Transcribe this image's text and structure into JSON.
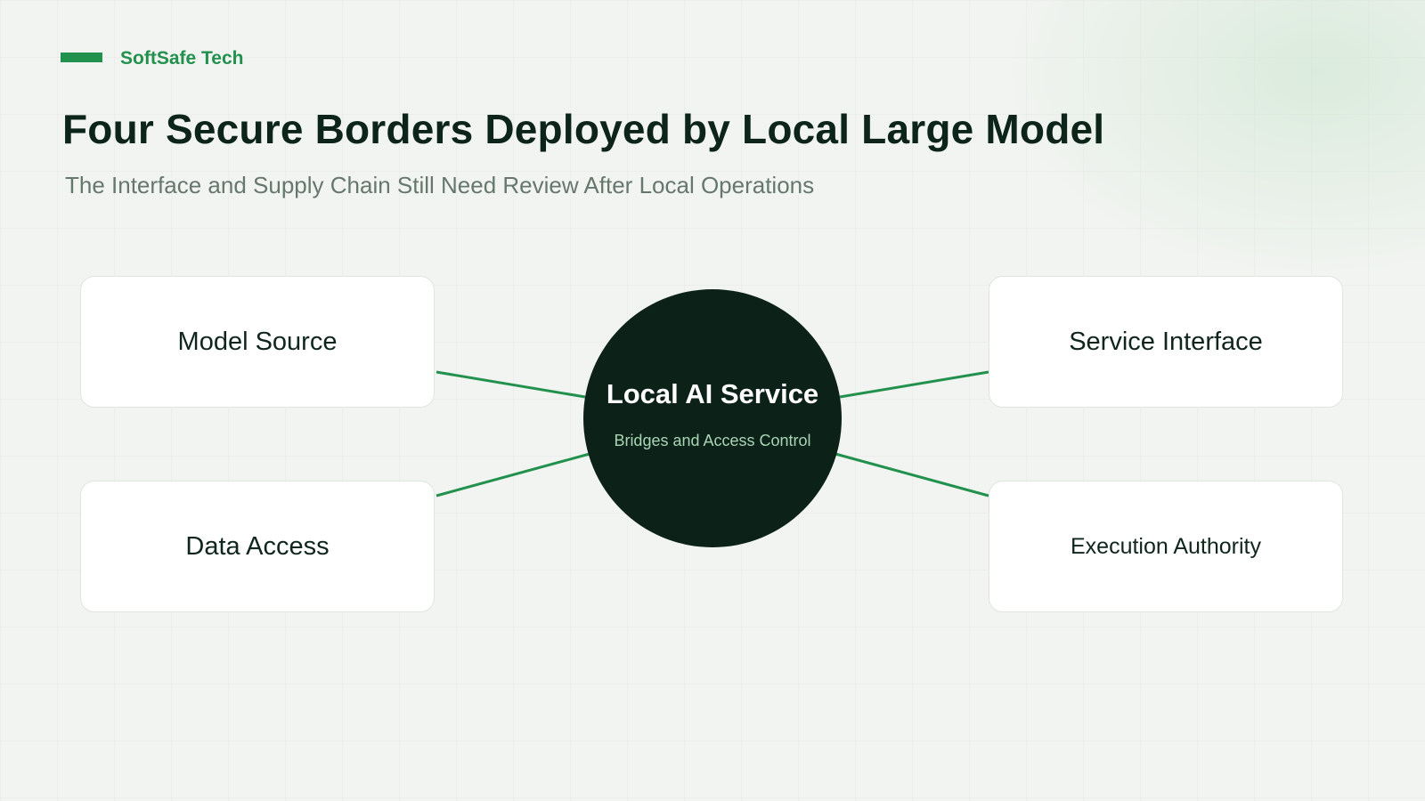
{
  "brand": {
    "name": "SoftSafe Tech"
  },
  "header": {
    "title": "Four Secure Borders Deployed by Local Large Model",
    "subtitle": "The Interface and Supply Chain Still Need Review After Local Operations"
  },
  "diagram": {
    "center": {
      "title": "Local AI Service",
      "subtitle": "Bridges and Access Control"
    },
    "nodes": [
      {
        "label": "Model Source"
      },
      {
        "label": "Service Interface"
      },
      {
        "label": "Data Access"
      },
      {
        "label": "Execution Authority"
      }
    ]
  },
  "colors": {
    "accent": "#23914e",
    "dark": "#0c2219",
    "connector": "#23914e",
    "box_background": "#ffffff",
    "page_background": "#f2f4f1"
  }
}
